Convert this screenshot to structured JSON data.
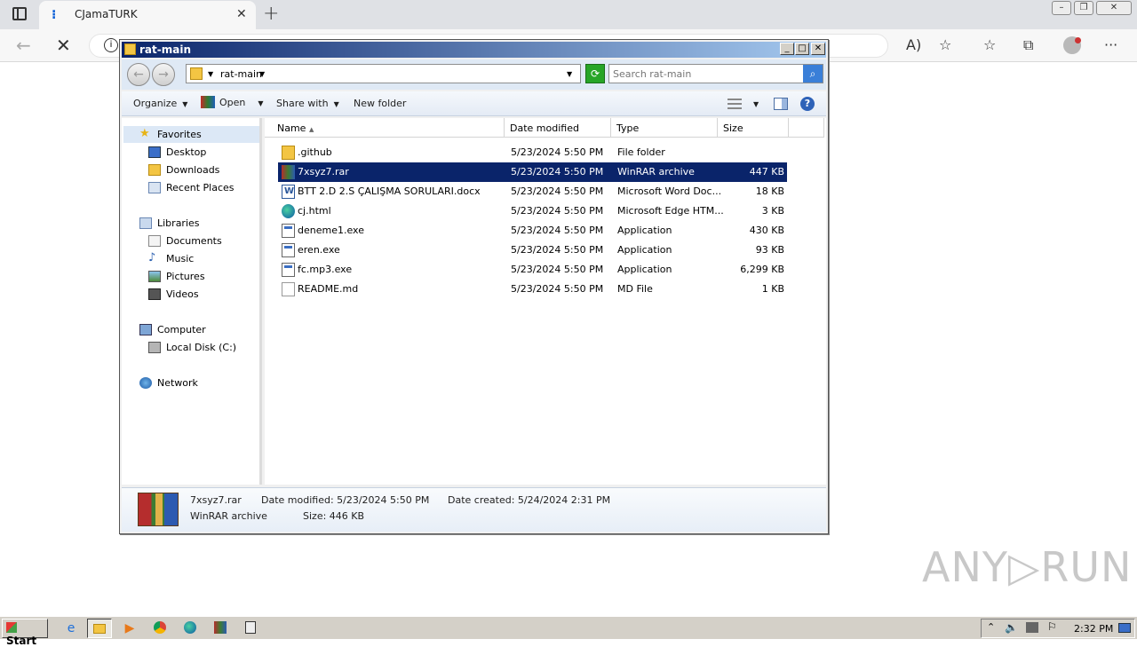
{
  "browser": {
    "tab_title": "CJamaTURK",
    "tab_close": "✕",
    "new_tab": "+",
    "win_min": "–",
    "win_max": "❐",
    "win_close": "✕",
    "back": "←",
    "stop": "✕",
    "info": "i",
    "read_aloud": "A)",
    "add_fav": "☆",
    "favorites": "☆",
    "collections": "⧉",
    "more": "···"
  },
  "explorer": {
    "title": "rat-main",
    "title_min": "_",
    "title_max": "□",
    "title_close": "✕",
    "nav_back": "←",
    "nav_forward": "→",
    "breadcrumb": "rat-main",
    "search_placeholder": "Search rat-main",
    "toolbar": {
      "organize": "Organize",
      "open": "Open",
      "share_with": "Share with",
      "new_folder": "New folder",
      "help": "?"
    },
    "nav_pane": {
      "favorites": "Favorites",
      "desktop": "Desktop",
      "downloads": "Downloads",
      "recent_places": "Recent Places",
      "libraries": "Libraries",
      "documents": "Documents",
      "music": "Music",
      "pictures": "Pictures",
      "videos": "Videos",
      "computer": "Computer",
      "local_disk": "Local Disk (C:)",
      "network": "Network"
    },
    "columns": {
      "name": "Name",
      "date_modified": "Date modified",
      "type": "Type",
      "size": "Size"
    },
    "files": [
      {
        "name": ".github",
        "date": "5/23/2024 5:50 PM",
        "type": "File folder",
        "size": ""
      },
      {
        "name": "7xsyz7.rar",
        "date": "5/23/2024 5:50 PM",
        "type": "WinRAR archive",
        "size": "447 KB"
      },
      {
        "name": "BTT 2.D 2.S ÇALIŞMA SORULARI.docx",
        "date": "5/23/2024 5:50 PM",
        "type": "Microsoft Word Doc...",
        "size": "18 KB"
      },
      {
        "name": "cj.html",
        "date": "5/23/2024 5:50 PM",
        "type": "Microsoft Edge HTM...",
        "size": "3 KB"
      },
      {
        "name": "deneme1.exe",
        "date": "5/23/2024 5:50 PM",
        "type": "Application",
        "size": "430 KB"
      },
      {
        "name": "eren.exe",
        "date": "5/23/2024 5:50 PM",
        "type": "Application",
        "size": "93 KB"
      },
      {
        "name": "fc.mp3.exe",
        "date": "5/23/2024 5:50 PM",
        "type": "Application",
        "size": "6,299 KB"
      },
      {
        "name": "README.md",
        "date": "5/23/2024 5:50 PM",
        "type": "MD File",
        "size": "1 KB"
      }
    ],
    "details": {
      "filename": "7xsyz7.rar",
      "filetype": "WinRAR archive",
      "date_modified": "Date modified: 5/23/2024 5:50 PM",
      "size": "Size: 446 KB",
      "date_created": "Date created: 5/24/2024 2:31 PM"
    }
  },
  "watermark": "ANY▷RUN",
  "taskbar": {
    "start": "Start",
    "clock": "2:32 PM"
  }
}
